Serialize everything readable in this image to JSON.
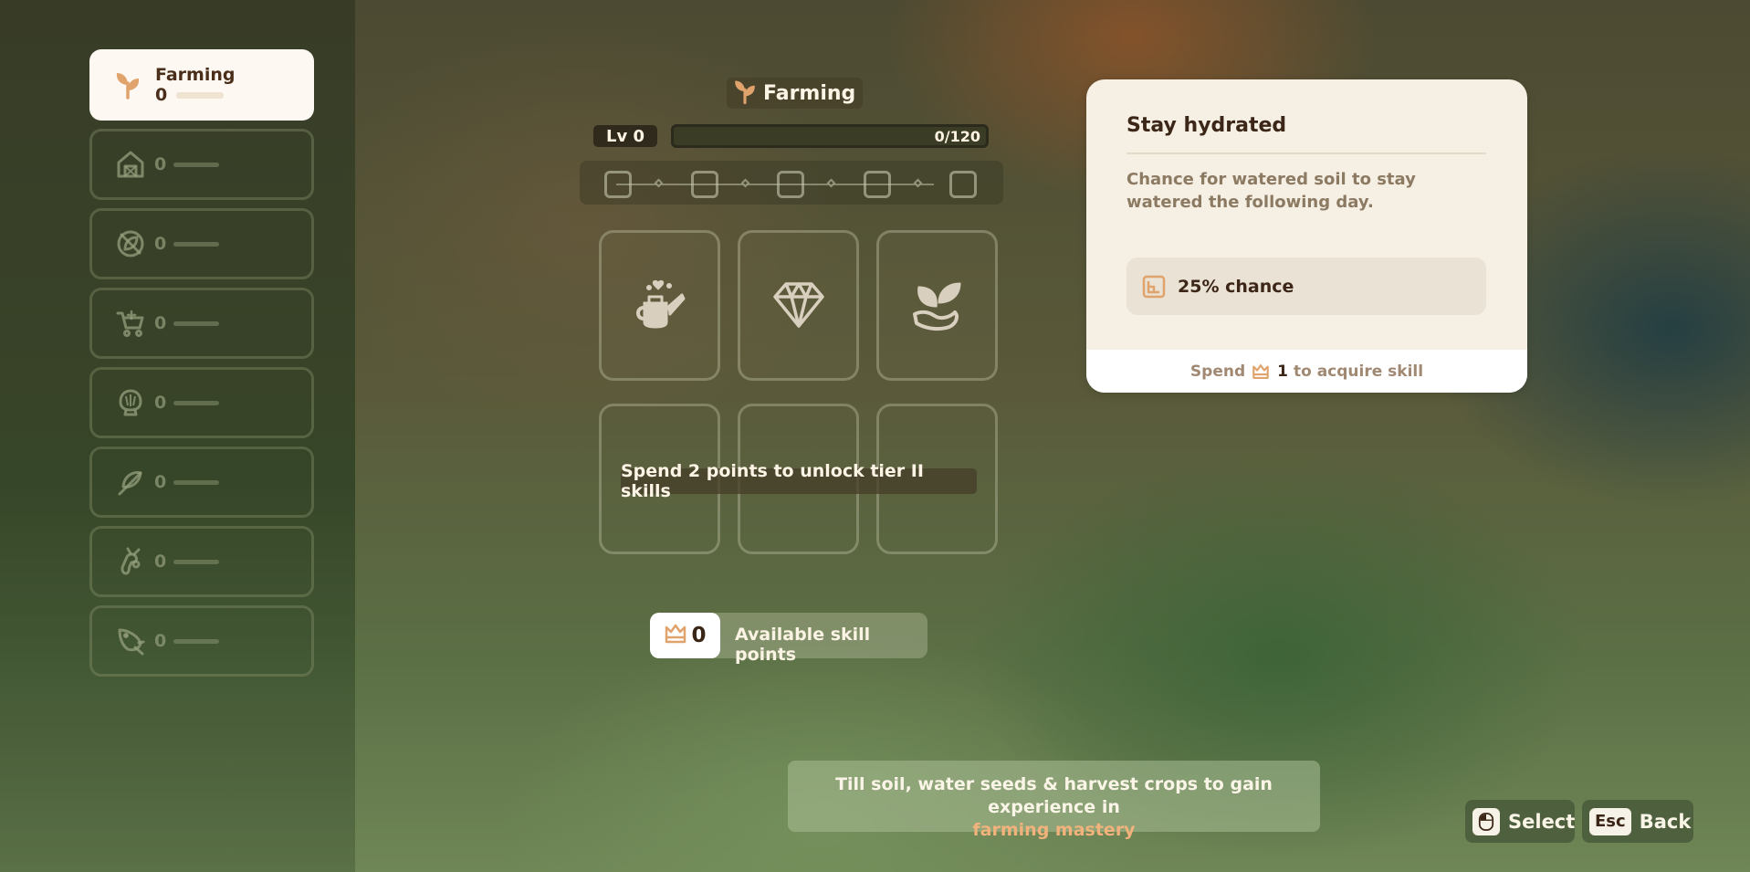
{
  "sidebar": {
    "items": [
      {
        "name": "Farming",
        "value": "0",
        "icon": "sprout-icon",
        "active": true
      },
      {
        "value": "0",
        "icon": "barn-icon"
      },
      {
        "value": "0",
        "icon": "leaf-disabled-icon"
      },
      {
        "value": "0",
        "icon": "cart-icon"
      },
      {
        "value": "0",
        "icon": "seashell-icon"
      },
      {
        "value": "0",
        "icon": "feather-icon"
      },
      {
        "value": "0",
        "icon": "bug-icon"
      },
      {
        "value": "0",
        "icon": "fish-icon"
      }
    ]
  },
  "skill": {
    "title": "Farming",
    "level": "Lv 0",
    "xp": "0/120",
    "xp_progress": 0,
    "track_slots": 5
  },
  "tiers": {
    "tier1": [
      "watering-can-icon",
      "gem-icon",
      "leaf-hand-icon"
    ],
    "lock_text": "Spend 2 points to unlock tier II skills"
  },
  "skill_points": {
    "count": "0",
    "label": "Available skill points"
  },
  "tooltip": {
    "title": "Stay hydrated",
    "description": "Chance for watered soil to stay watered the following day.",
    "stat": "25% chance",
    "footer_prefix": "Spend",
    "footer_cost": "1",
    "footer_suffix": "to acquire skill"
  },
  "hint": {
    "text": "Till soil, water seeds & harvest crops to gain experience in",
    "highlight": "farming mastery"
  },
  "controls": {
    "select": {
      "key": "",
      "label": "Select"
    },
    "back": {
      "key": "Esc",
      "label": "Back"
    }
  },
  "colors": {
    "accent": "#f2b27c",
    "panel": "#f5efe4",
    "dark_text": "#3c2617"
  }
}
